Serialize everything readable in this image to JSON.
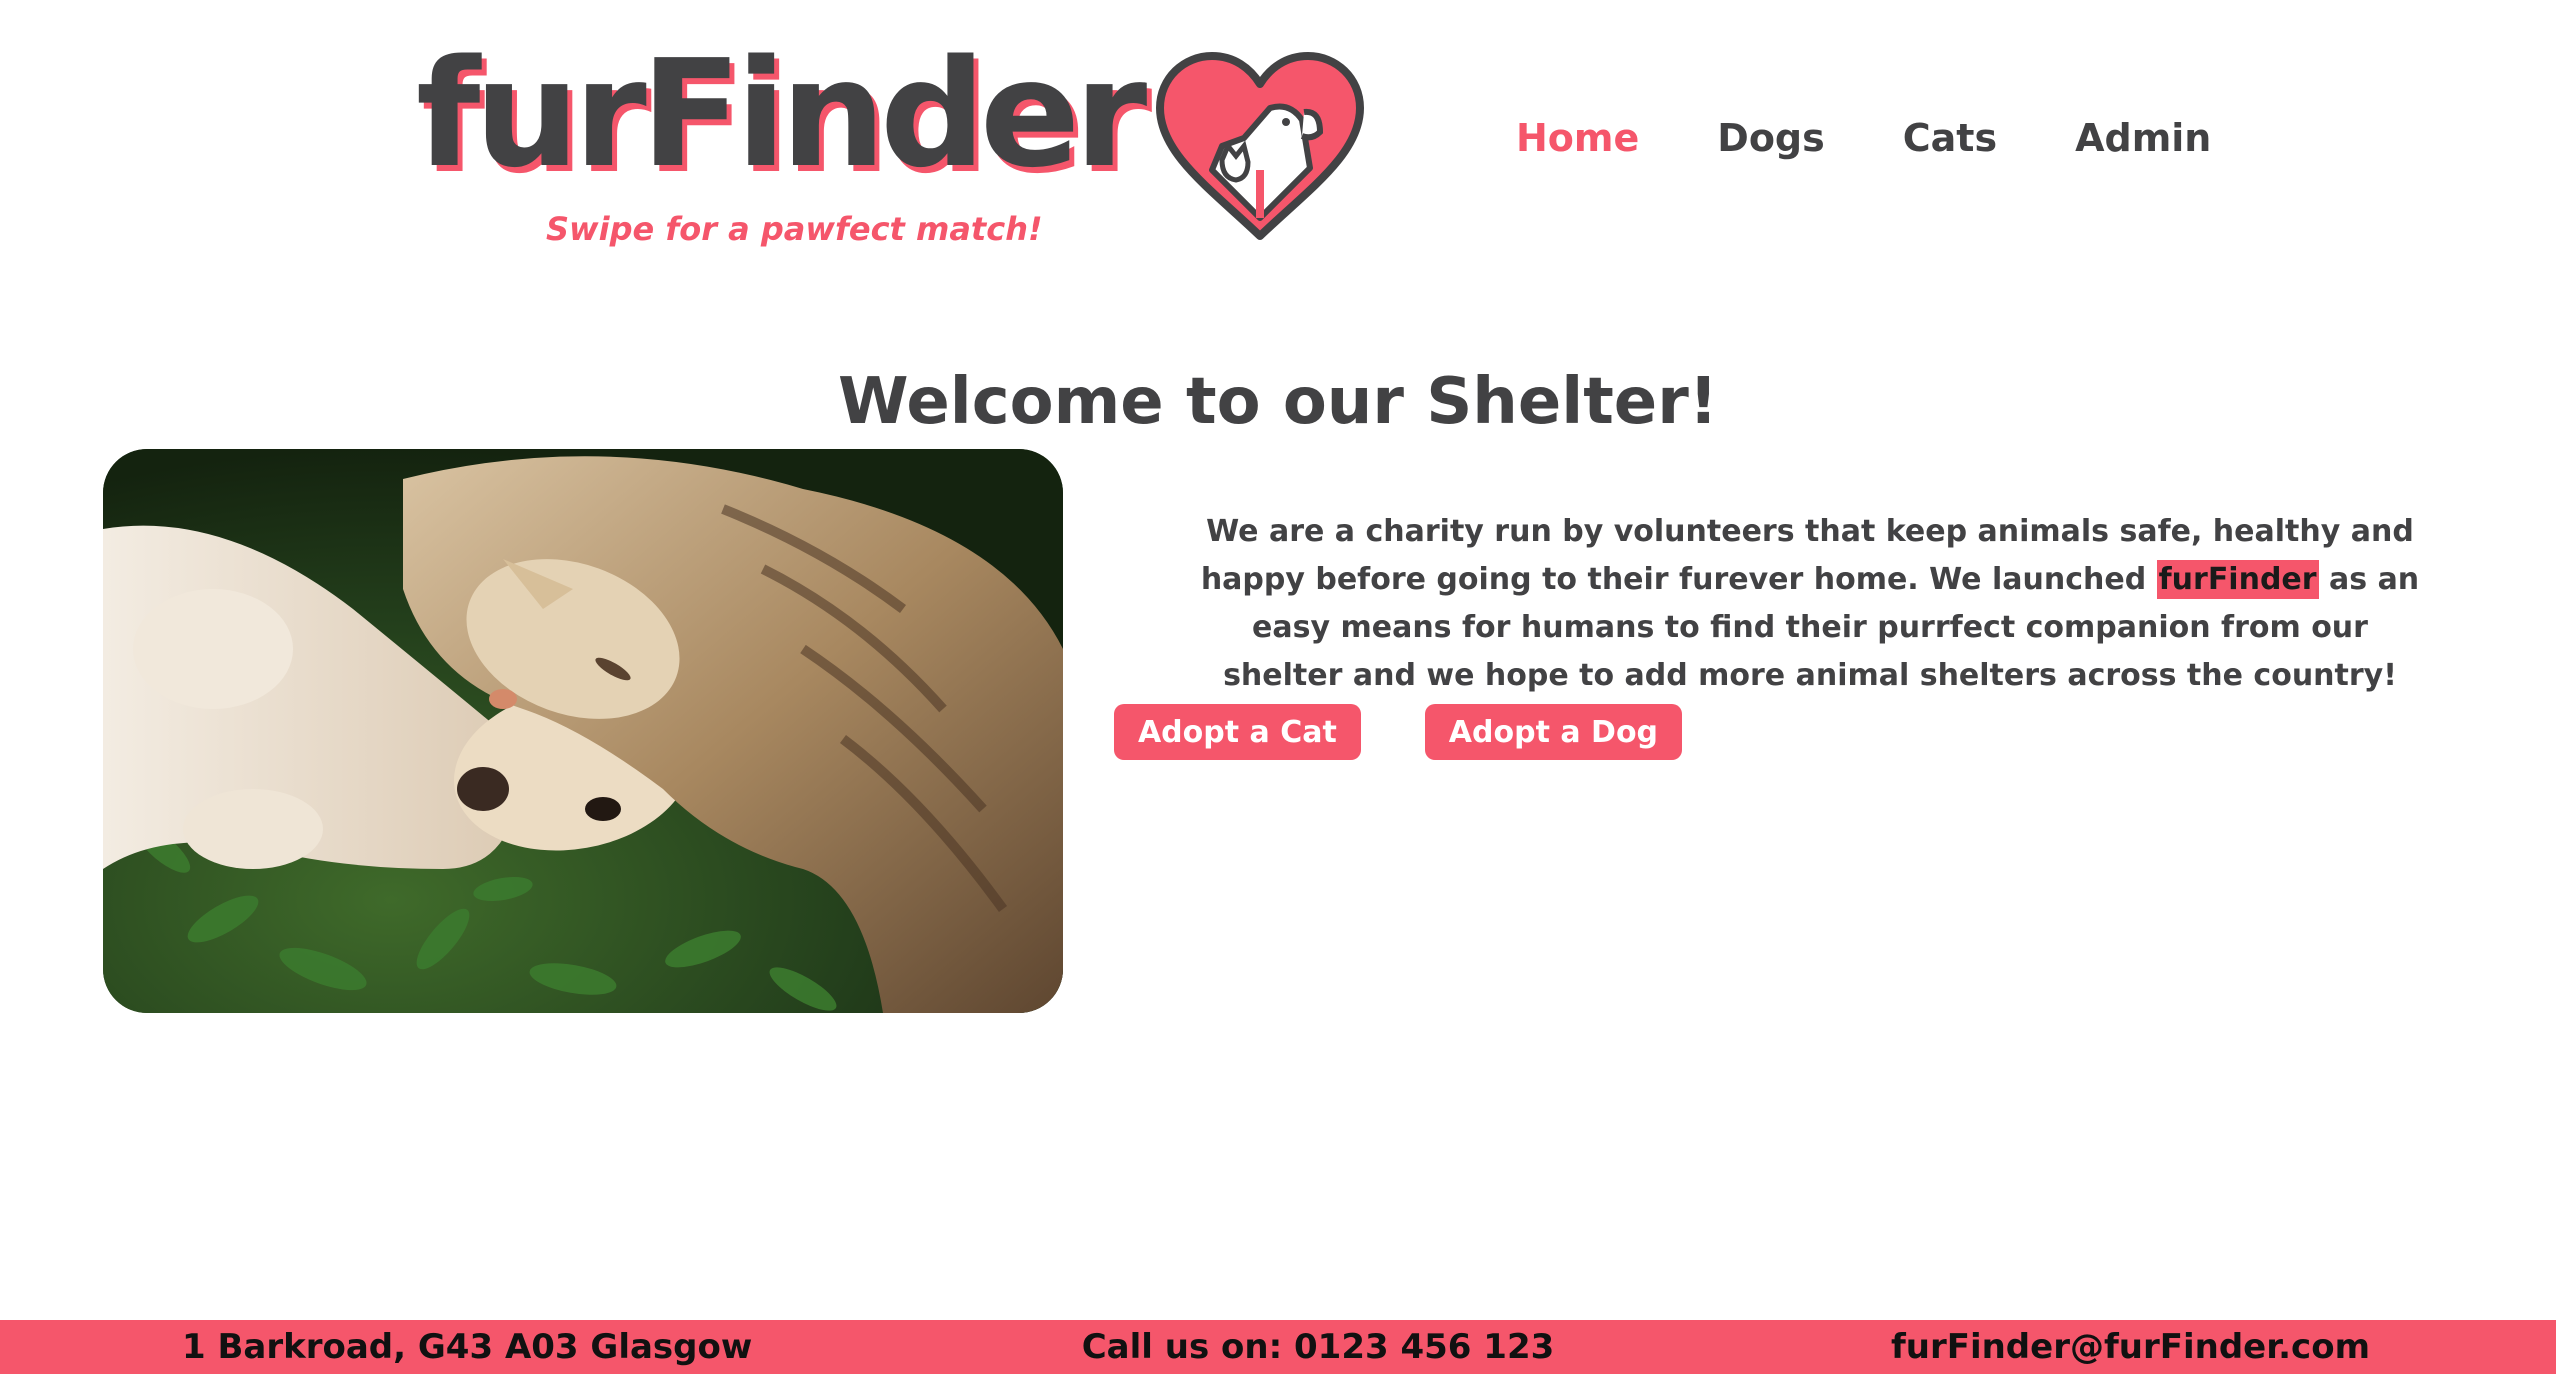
{
  "brand": {
    "name": "furFinder",
    "tagline": "Swipe for a pawfect match!",
    "logo_icon": "heart-with-dog-and-cat-icon"
  },
  "nav": {
    "items": [
      {
        "label": "Home",
        "active": true
      },
      {
        "label": "Dogs",
        "active": false
      },
      {
        "label": "Cats",
        "active": false
      },
      {
        "label": "Admin",
        "active": false
      }
    ]
  },
  "main": {
    "heading": "Welcome to our Shelter!",
    "intro_before": "We are a charity run by volunteers that keep animals safe, healthy and happy before going to their furever home. We launched ",
    "intro_highlight": "furFinder",
    "intro_after": " as an easy means for humans to find their purrfect companion from our shelter and we hope to add more animal shelters across the country!",
    "buttons": {
      "adopt_cat": "Adopt a Cat",
      "adopt_dog": "Adopt a Dog"
    }
  },
  "footer": {
    "address": "1 Barkroad, G43 A03 Glasgow",
    "phone": "Call us on: 0123 456 123",
    "email": "furFinder@furFinder.com"
  },
  "colors": {
    "accent": "#f5566b",
    "text": "#424244",
    "background": "#ffffff"
  }
}
